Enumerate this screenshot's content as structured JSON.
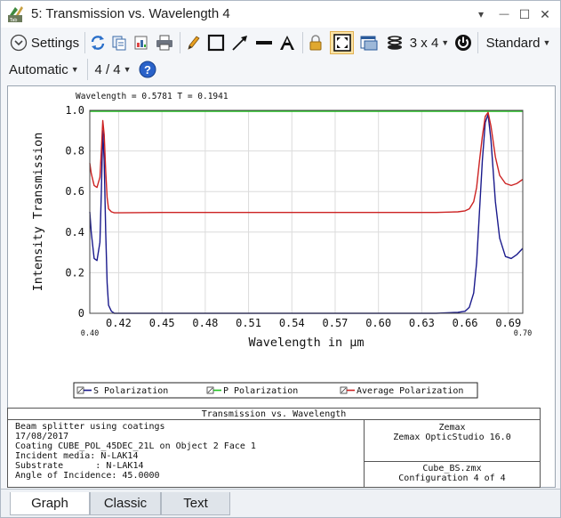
{
  "window": {
    "title": "5: Transmission vs. Wavelength 4",
    "controls": {
      "dropdown": "▾",
      "minimize": "—",
      "maximize": "☐",
      "close": "✕"
    }
  },
  "toolbar": {
    "settings_label": "Settings",
    "layout_label": "3 x 4",
    "standard_label": "Standard",
    "automatic_label": "Automatic",
    "page_label": "4 / 4",
    "icons": [
      "chevron-down-circle-icon",
      "refresh-icon",
      "copy-icon",
      "export-icon",
      "print-icon",
      "pencil-icon",
      "rectangle-icon",
      "arrow-icon",
      "line-icon",
      "text-icon",
      "lock-icon",
      "fit-icon",
      "window-icon",
      "layers-icon",
      "layout-icon",
      "power-icon",
      "help-icon"
    ]
  },
  "plot": {
    "cursor_readout": "Wavelength = 0.5781   T = 0.1941",
    "colors": {
      "s": "#1a1a8c",
      "p": "#22c322",
      "avg": "#cc2222"
    }
  },
  "chart_data": {
    "type": "line",
    "title": "",
    "xlabel": "Wavelength in µm",
    "ylabel": "Intensity Transmission",
    "xlim": [
      0.4,
      0.7
    ],
    "ylim": [
      0,
      1.0
    ],
    "x_ticks": [
      "0.42",
      "0.45",
      "0.48",
      "0.51",
      "0.54",
      "0.57",
      "0.60",
      "0.63",
      "0.66",
      "0.69"
    ],
    "x_end_labels": [
      "0.40",
      "0.70"
    ],
    "y_ticks": [
      "0",
      "0.2",
      "0.4",
      "0.6",
      "0.8",
      "1.0"
    ],
    "grid": true,
    "legend_placement": "bottom",
    "series": [
      {
        "name": "S Polarization",
        "color": "#1a1a8c",
        "x": [
          0.4,
          0.401,
          0.403,
          0.405,
          0.407,
          0.408,
          0.409,
          0.41,
          0.411,
          0.412,
          0.413,
          0.415,
          0.417,
          0.42,
          0.45,
          0.5,
          0.55,
          0.6,
          0.64,
          0.655,
          0.66,
          0.663,
          0.666,
          0.668,
          0.67,
          0.672,
          0.674,
          0.676,
          0.678,
          0.681,
          0.684,
          0.688,
          0.692,
          0.696,
          0.7
        ],
        "values": [
          0.5,
          0.4,
          0.27,
          0.26,
          0.35,
          0.6,
          0.9,
          0.75,
          0.4,
          0.15,
          0.04,
          0.01,
          0.0,
          0.0,
          0.0,
          0.0,
          0.0,
          0.0,
          0.0,
          0.005,
          0.01,
          0.03,
          0.1,
          0.25,
          0.5,
          0.75,
          0.94,
          0.98,
          0.85,
          0.55,
          0.37,
          0.28,
          0.27,
          0.29,
          0.32
        ]
      },
      {
        "name": "P Polarization",
        "color": "#22c322",
        "x": [
          0.4,
          0.45,
          0.5,
          0.55,
          0.6,
          0.65,
          0.7
        ],
        "values": [
          0.995,
          0.995,
          0.995,
          0.995,
          0.995,
          0.995,
          0.995
        ]
      },
      {
        "name": "Average Polarization",
        "color": "#cc2222",
        "x": [
          0.4,
          0.401,
          0.403,
          0.405,
          0.407,
          0.408,
          0.409,
          0.41,
          0.411,
          0.412,
          0.413,
          0.415,
          0.417,
          0.42,
          0.45,
          0.5,
          0.55,
          0.6,
          0.64,
          0.655,
          0.66,
          0.663,
          0.666,
          0.668,
          0.67,
          0.672,
          0.674,
          0.676,
          0.678,
          0.681,
          0.684,
          0.688,
          0.692,
          0.696,
          0.7
        ],
        "values": [
          0.74,
          0.69,
          0.63,
          0.62,
          0.67,
          0.8,
          0.95,
          0.88,
          0.7,
          0.57,
          0.515,
          0.5,
          0.495,
          0.495,
          0.497,
          0.497,
          0.497,
          0.497,
          0.497,
          0.5,
          0.505,
          0.515,
          0.55,
          0.62,
          0.75,
          0.87,
          0.97,
          0.99,
          0.92,
          0.77,
          0.68,
          0.64,
          0.63,
          0.64,
          0.66
        ]
      }
    ]
  },
  "info": {
    "title": "Transmission vs. Wavelength",
    "left_lines": "Beam splitter using coatings\n17/08/2017\nCoating CUBE_POL_45DEC_21L on Object 2 Face 1\nIncident media: N-LAK14\nSubstrate      : N-LAK14\nAngle of Incidence: 45.0000",
    "right_top_1": "Zemax",
    "right_top_2": "Zemax OpticStudio 16.0",
    "right_bottom_1": "Cube_BS.zmx",
    "right_bottom_2": "Configuration 4 of 4"
  },
  "tabs": [
    {
      "label": "Graph",
      "active": true
    },
    {
      "label": "Classic",
      "active": false
    },
    {
      "label": "Text",
      "active": false
    }
  ]
}
